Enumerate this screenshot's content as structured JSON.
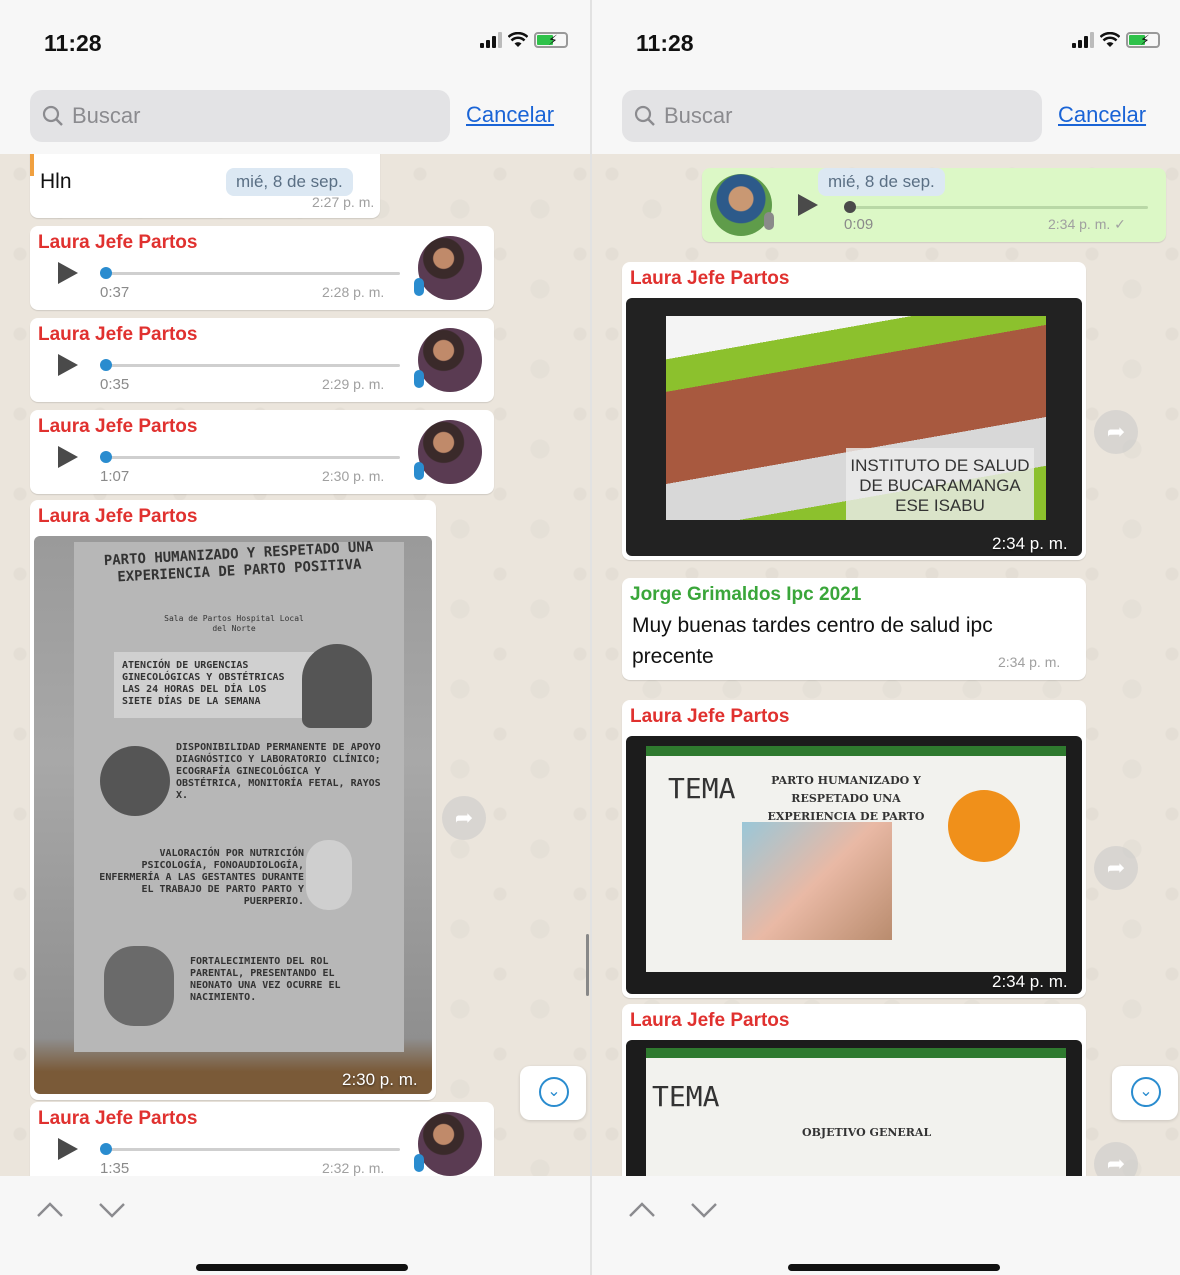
{
  "status": {
    "time": "11:28"
  },
  "search": {
    "placeholder": "Buscar",
    "cancel": "Cancelar"
  },
  "left": {
    "partial_message": {
      "text": "Hln",
      "time": "2:27 p. m."
    },
    "date_chip": "mié, 8 de sep.",
    "voice_notes": [
      {
        "sender": "Laura Jefe Partos",
        "duration": "0:37",
        "time": "2:28 p. m."
      },
      {
        "sender": "Laura Jefe Partos",
        "duration": "0:35",
        "time": "2:29 p. m."
      },
      {
        "sender": "Laura Jefe Partos",
        "duration": "1:07",
        "time": "2:30 p. m."
      }
    ],
    "image_message": {
      "sender": "Laura Jefe Partos",
      "time": "2:30 p. m.",
      "poster": {
        "heading": "PARTO HUMANIZADO Y RESPETADO UNA EXPERIENCIA DE PARTO POSITIVA",
        "sub": "Sala de Partos Hospital Local del Norte",
        "block1": "ATENCIÓN DE URGENCIAS GINECOLÓGICAS Y OBSTÉTRICAS LAS 24 HORAS DEL DÍA LOS SIETE DÍAS DE LA SEMANA",
        "block2": "DISPONIBILIDAD PERMANENTE DE APOYO DIAGNÓSTICO Y LABORATORIO CLÍNICO; ECOGRAFÍA GINECOLÓGICA Y OBSTÉTRICA, MONITORÍA FETAL, RAYOS X.",
        "block3": "VALORACIÓN POR NUTRICIÓN PSICOLOGÍA, FONOAUDIOLOGÍA, ENFERMERÍA A LAS GESTANTES DURANTE EL TRABAJO DE PARTO PARTO Y PUERPERIO.",
        "block4": "FORTALECIMIENTO DEL ROL PARENTAL, PRESENTANDO EL NEONATO UNA VEZ OCURRE EL NACIMIENTO."
      }
    },
    "last_voice": {
      "sender": "Laura Jefe Partos",
      "duration": "1:35",
      "time": "2:32 p. m."
    }
  },
  "right": {
    "date_chip": "mié, 8 de sep.",
    "outgoing_voice": {
      "duration": "0:09",
      "time": "2:34 p. m. ✓"
    },
    "image1": {
      "sender": "Laura Jefe Partos",
      "time": "2:34 p. m.",
      "caption": "INSTITUTO DE SALUD DE BUCARAMANGA ESE ISABU"
    },
    "text_message": {
      "sender": "Jorge Grimaldos Ipc 2021",
      "text": "Muy buenas tardes centro de salud ipc precente",
      "time": "2:34 p. m."
    },
    "image2": {
      "sender": "Laura Jefe Partos",
      "time": "2:34 p. m.",
      "tema": "TEMA",
      "title": "PARTO HUMANIZADO Y RESPETADO UNA EXPERIENCIA DE PARTO POSITIVA"
    },
    "image3": {
      "sender": "Laura Jefe Partos",
      "tema": "TEMA",
      "subtitle": "OBJETIVO GENERAL"
    }
  },
  "colors": {
    "sender_red": "#e0312f",
    "sender_green": "#3aa63a",
    "link_blue": "#1a64d6",
    "outgoing_bubble": "#dcf8c6"
  }
}
